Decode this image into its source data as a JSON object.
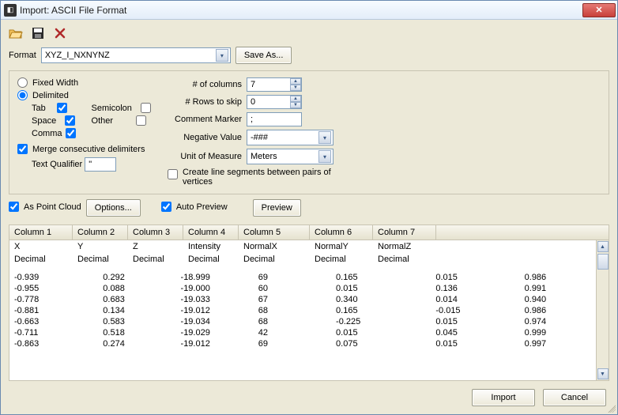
{
  "window": {
    "title": "Import: ASCII File Format"
  },
  "toolbar": {
    "open_icon": "open-icon",
    "save_icon": "save-icon",
    "delete_icon": "delete-icon"
  },
  "format": {
    "label": "Format",
    "value": "XYZ_I_NXNYNZ",
    "saveas": "Save As..."
  },
  "delimit": {
    "fixed_label": "Fixed Width",
    "delimited_label": "Delimited",
    "tab": "Tab",
    "space": "Space",
    "comma": "Comma",
    "semicolon": "Semicolon",
    "other": "Other",
    "merge": "Merge consecutive delimiters",
    "textq_label": "Text Qualifier",
    "textq_value": "\""
  },
  "numeric": {
    "cols_label": "# of columns",
    "cols_value": "7",
    "skip_label": "# Rows to skip",
    "skip_value": "0",
    "comment_label": "Comment Marker",
    "comment_value": ";",
    "neg_label": "Negative Value",
    "neg_value": "-###",
    "unit_label": "Unit of Measure",
    "unit_value": "Meters",
    "lineseg": "Create line segments between pairs of vertices"
  },
  "options": {
    "pointcloud": "As Point Cloud",
    "options_btn": "Options...",
    "autoprev": "Auto Preview",
    "preview_btn": "Preview"
  },
  "grid": {
    "headers": [
      "Column 1",
      "Column 2",
      "Column 3",
      "Column 4",
      "Column 5",
      "Column 6",
      "Column 7"
    ],
    "names": [
      "X",
      "Y",
      "Z",
      "Intensity",
      "NormalX",
      "NormalY",
      "NormalZ"
    ],
    "types": [
      "Decimal",
      "Decimal",
      "Decimal",
      "Decimal",
      "Decimal",
      "Decimal",
      "Decimal"
    ],
    "rows": [
      [
        "-0.939",
        "0.292",
        "-18.999",
        "69",
        "0.165",
        "0.015",
        "0.986"
      ],
      [
        "-0.955",
        "0.088",
        "-19.000",
        "60",
        "0.015",
        "0.136",
        "0.991"
      ],
      [
        "-0.778",
        "0.683",
        "-19.033",
        "67",
        "0.340",
        "0.014",
        "0.940"
      ],
      [
        "-0.881",
        "0.134",
        "-19.012",
        "68",
        "0.165",
        "-0.015",
        "0.986"
      ],
      [
        "-0.663",
        "0.583",
        "-19.034",
        "68",
        "-0.225",
        "0.015",
        "0.974"
      ],
      [
        "-0.711",
        "0.518",
        "-19.029",
        "42",
        "0.015",
        "0.045",
        "0.999"
      ],
      [
        "-0.863",
        "0.274",
        "-19.012",
        "69",
        "0.075",
        "0.015",
        "0.997"
      ]
    ]
  },
  "footer": {
    "import": "Import",
    "cancel": "Cancel"
  }
}
